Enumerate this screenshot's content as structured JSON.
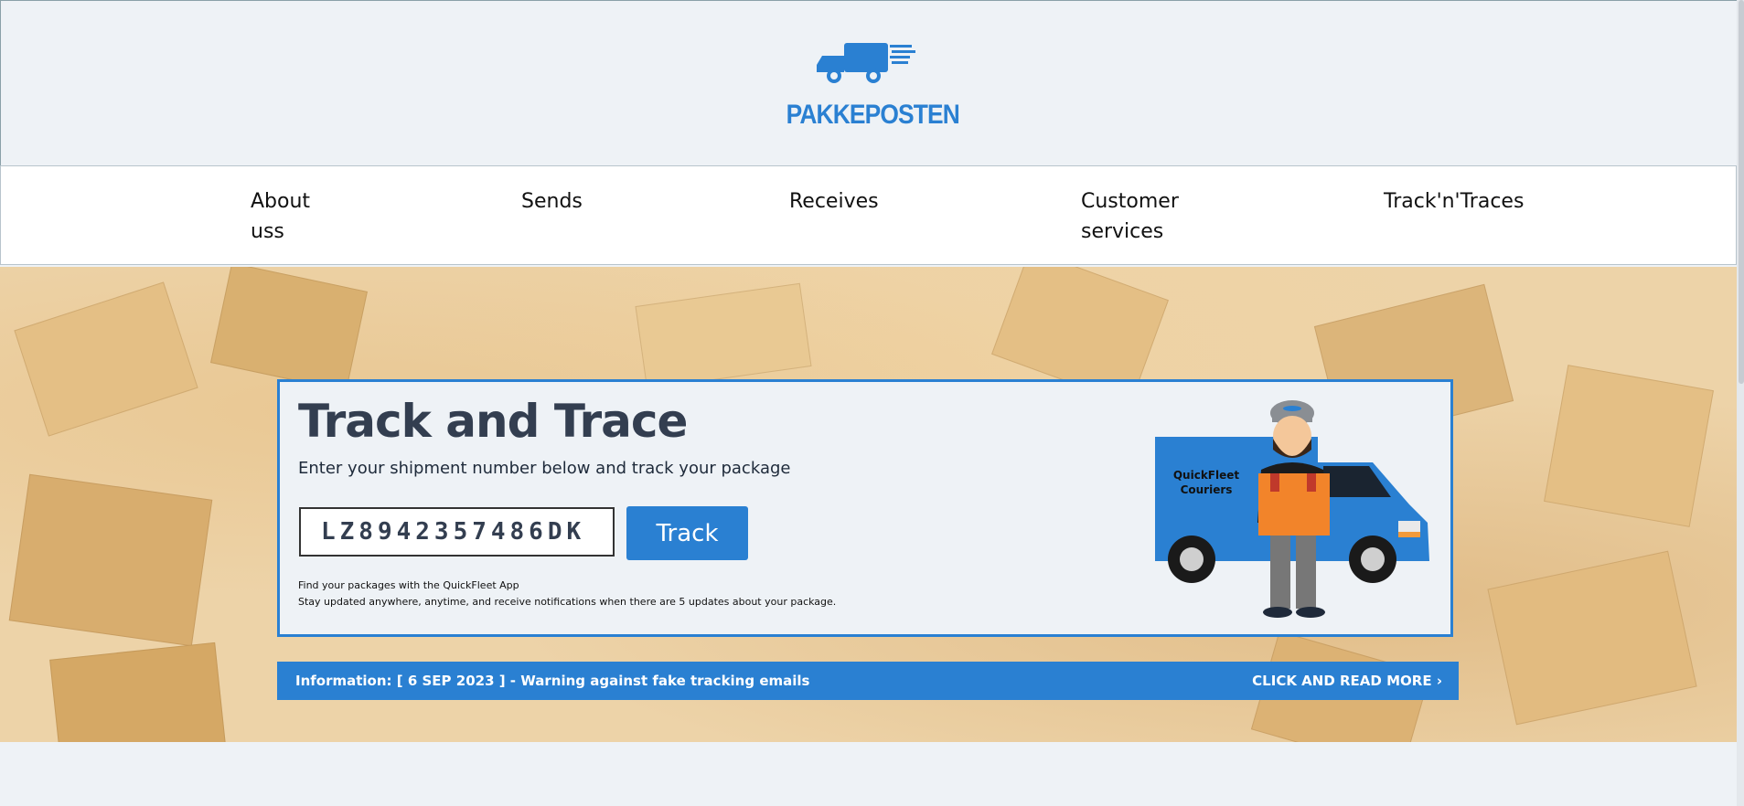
{
  "header": {
    "logo_text": "PAKKEPOSTEN",
    "logo_icon": "truck-icon"
  },
  "nav": {
    "items": [
      {
        "line1": "About",
        "line2": "uss"
      },
      {
        "line1": "Sends",
        "line2": ""
      },
      {
        "line1": "Receives",
        "line2": ""
      },
      {
        "line1": "Customer",
        "line2": "services"
      },
      {
        "line1": "Track'n'Traces",
        "line2": ""
      }
    ]
  },
  "tracking": {
    "title": "Track and Trace",
    "subtitle": "Enter your shipment number below and track your package",
    "input_value": "LZ8942357486DK",
    "button_label": "Track",
    "app_line1": "Find your packages with the QuickFleet App",
    "app_line2": "Stay updated anywhere, anytime, and receive notifications when there are 5 updates about your package.",
    "van_label_line1": "QuickFleet",
    "van_label_line2": "Couriers"
  },
  "info_bar": {
    "text": "Information: [ 6 SEP 2023 ] - Warning against fake tracking emails",
    "link_label": "CLICK AND READ MORE",
    "link_icon": "chevron-right-icon"
  },
  "colors": {
    "accent": "#2a80d2",
    "panel_bg": "#eef2f6",
    "title": "#333e50"
  }
}
